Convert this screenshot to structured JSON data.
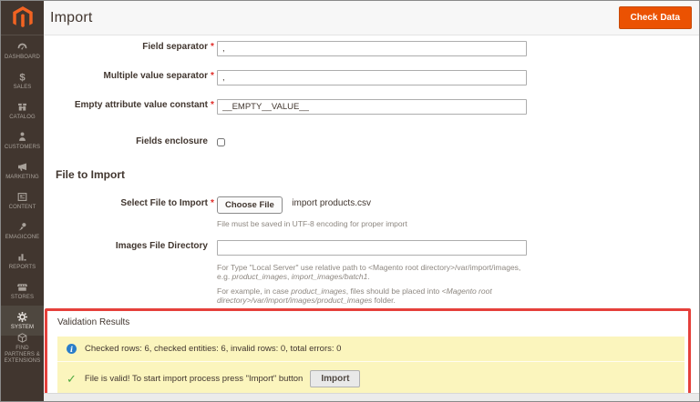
{
  "header": {
    "title": "Import",
    "check_data_label": "Check Data"
  },
  "required_marker": "*",
  "sidebar": {
    "items": [
      {
        "label": "DASHBOARD",
        "icon": "dashboard-icon"
      },
      {
        "label": "SALES",
        "icon": "sales-icon"
      },
      {
        "label": "CATALOG",
        "icon": "catalog-icon"
      },
      {
        "label": "CUSTOMERS",
        "icon": "customers-icon"
      },
      {
        "label": "MARKETING",
        "icon": "marketing-icon"
      },
      {
        "label": "CONTENT",
        "icon": "content-icon"
      },
      {
        "label": "EMAGICONE",
        "icon": "emagicone-icon"
      },
      {
        "label": "REPORTS",
        "icon": "reports-icon"
      },
      {
        "label": "STORES",
        "icon": "stores-icon"
      },
      {
        "label": "SYSTEM",
        "icon": "system-icon",
        "selected": true
      },
      {
        "label": "FIND PARTNERS & EXTENSIONS",
        "icon": "extensions-icon"
      }
    ]
  },
  "form": {
    "field_separator": {
      "label": "Field separator",
      "value": ","
    },
    "multiple_value_separator": {
      "label": "Multiple value separator",
      "value": ","
    },
    "empty_attribute_value_constant": {
      "label": "Empty attribute value constant",
      "value": "__EMPTY__VALUE__"
    },
    "fields_enclosure": {
      "label": "Fields enclosure",
      "checked": false
    },
    "file_to_import_heading": "File to Import",
    "select_file": {
      "label": "Select File to Import",
      "button_label": "Choose File",
      "file_name": "import products.csv",
      "note": "File must be saved in UTF-8 encoding for proper import"
    },
    "images_file_directory": {
      "label": "Images File Directory",
      "value": "",
      "note1": {
        "pre": "For Type \"Local Server\" use relative path to <Magento root directory>/var/import/images, e.g. ",
        "italic1": "product_images",
        "mid": ", ",
        "italic2": "import_images/batch1",
        "post": "."
      },
      "note2": {
        "pre": "For example, in case ",
        "italic1": "product_images",
        "mid": ", files should be placed into ",
        "italic2": "<Magento root directory>/var/import/images/product_images",
        "post": " folder."
      }
    }
  },
  "validation": {
    "title": "Validation Results",
    "notice_text": "Checked rows: 6, checked entities: 6, invalid rows: 0, total errors: 0",
    "success_text": "File is valid! To start import process press \"Import\" button",
    "import_button_label": "Import"
  },
  "icons": {
    "info_glyph": "i",
    "success_glyph": "✓"
  },
  "colors": {
    "accent_orange": "#eb5202",
    "annotation_red": "#e5403b",
    "message_yellow": "#fbf5bd",
    "info_blue": "#2a7dc9",
    "success_green": "#4ea940",
    "sidebar_brown": "#41362f"
  }
}
